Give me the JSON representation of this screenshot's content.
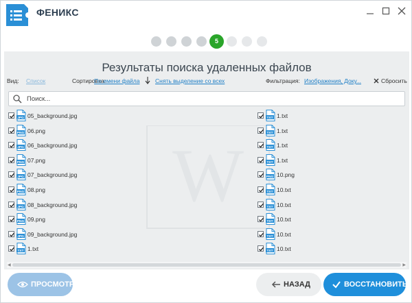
{
  "app": {
    "title": "ФЕНИКС"
  },
  "steps": {
    "current": "5"
  },
  "heading": "Результаты поиска удаленных файлов",
  "toolbar": {
    "view_label": "Вид:",
    "view_value": "Список",
    "sort_label": "Сортировка:",
    "sort_value": "По имени файла",
    "deselect": "Снять выделение со всех",
    "filter_label": "Фильтрация:",
    "filter_value": "Изображения, Доку...",
    "reset": "Сбросить"
  },
  "search": {
    "placeholder": "Поиск..."
  },
  "files": {
    "left": [
      {
        "name": "05_background.jpg",
        "type": "JPG"
      },
      {
        "name": "06.png",
        "type": "PNG"
      },
      {
        "name": "06_background.jpg",
        "type": "JPG"
      },
      {
        "name": "07.png",
        "type": "PNG"
      },
      {
        "name": "07_background.jpg",
        "type": "JPG"
      },
      {
        "name": "08.png",
        "type": "PNG"
      },
      {
        "name": "08_background.jpg",
        "type": "JPG"
      },
      {
        "name": "09.png",
        "type": "PNG"
      },
      {
        "name": "09_background.jpg",
        "type": "JPG"
      },
      {
        "name": "1.txt",
        "type": "TXT"
      }
    ],
    "right": [
      {
        "name": "1.txt",
        "type": "TXT"
      },
      {
        "name": "1.txt",
        "type": "TXT"
      },
      {
        "name": "1.txt",
        "type": "TXT"
      },
      {
        "name": "1.txt",
        "type": "TXT"
      },
      {
        "name": "10.png",
        "type": "PNG"
      },
      {
        "name": "10.txt",
        "type": "TXT"
      },
      {
        "name": "10.txt",
        "type": "TXT"
      },
      {
        "name": "10.txt",
        "type": "TXT"
      },
      {
        "name": "10.txt",
        "type": "TXT"
      },
      {
        "name": "10.txt",
        "type": "TXT"
      }
    ]
  },
  "buttons": {
    "preview": "ПРОСМОТР",
    "back": "НАЗАД",
    "restore": "ВОССТАНОВИТЬ"
  },
  "colors": {
    "accent": "#1f8fdb",
    "step_active": "#2aa52a",
    "file_icon": "#2a8fd6"
  }
}
